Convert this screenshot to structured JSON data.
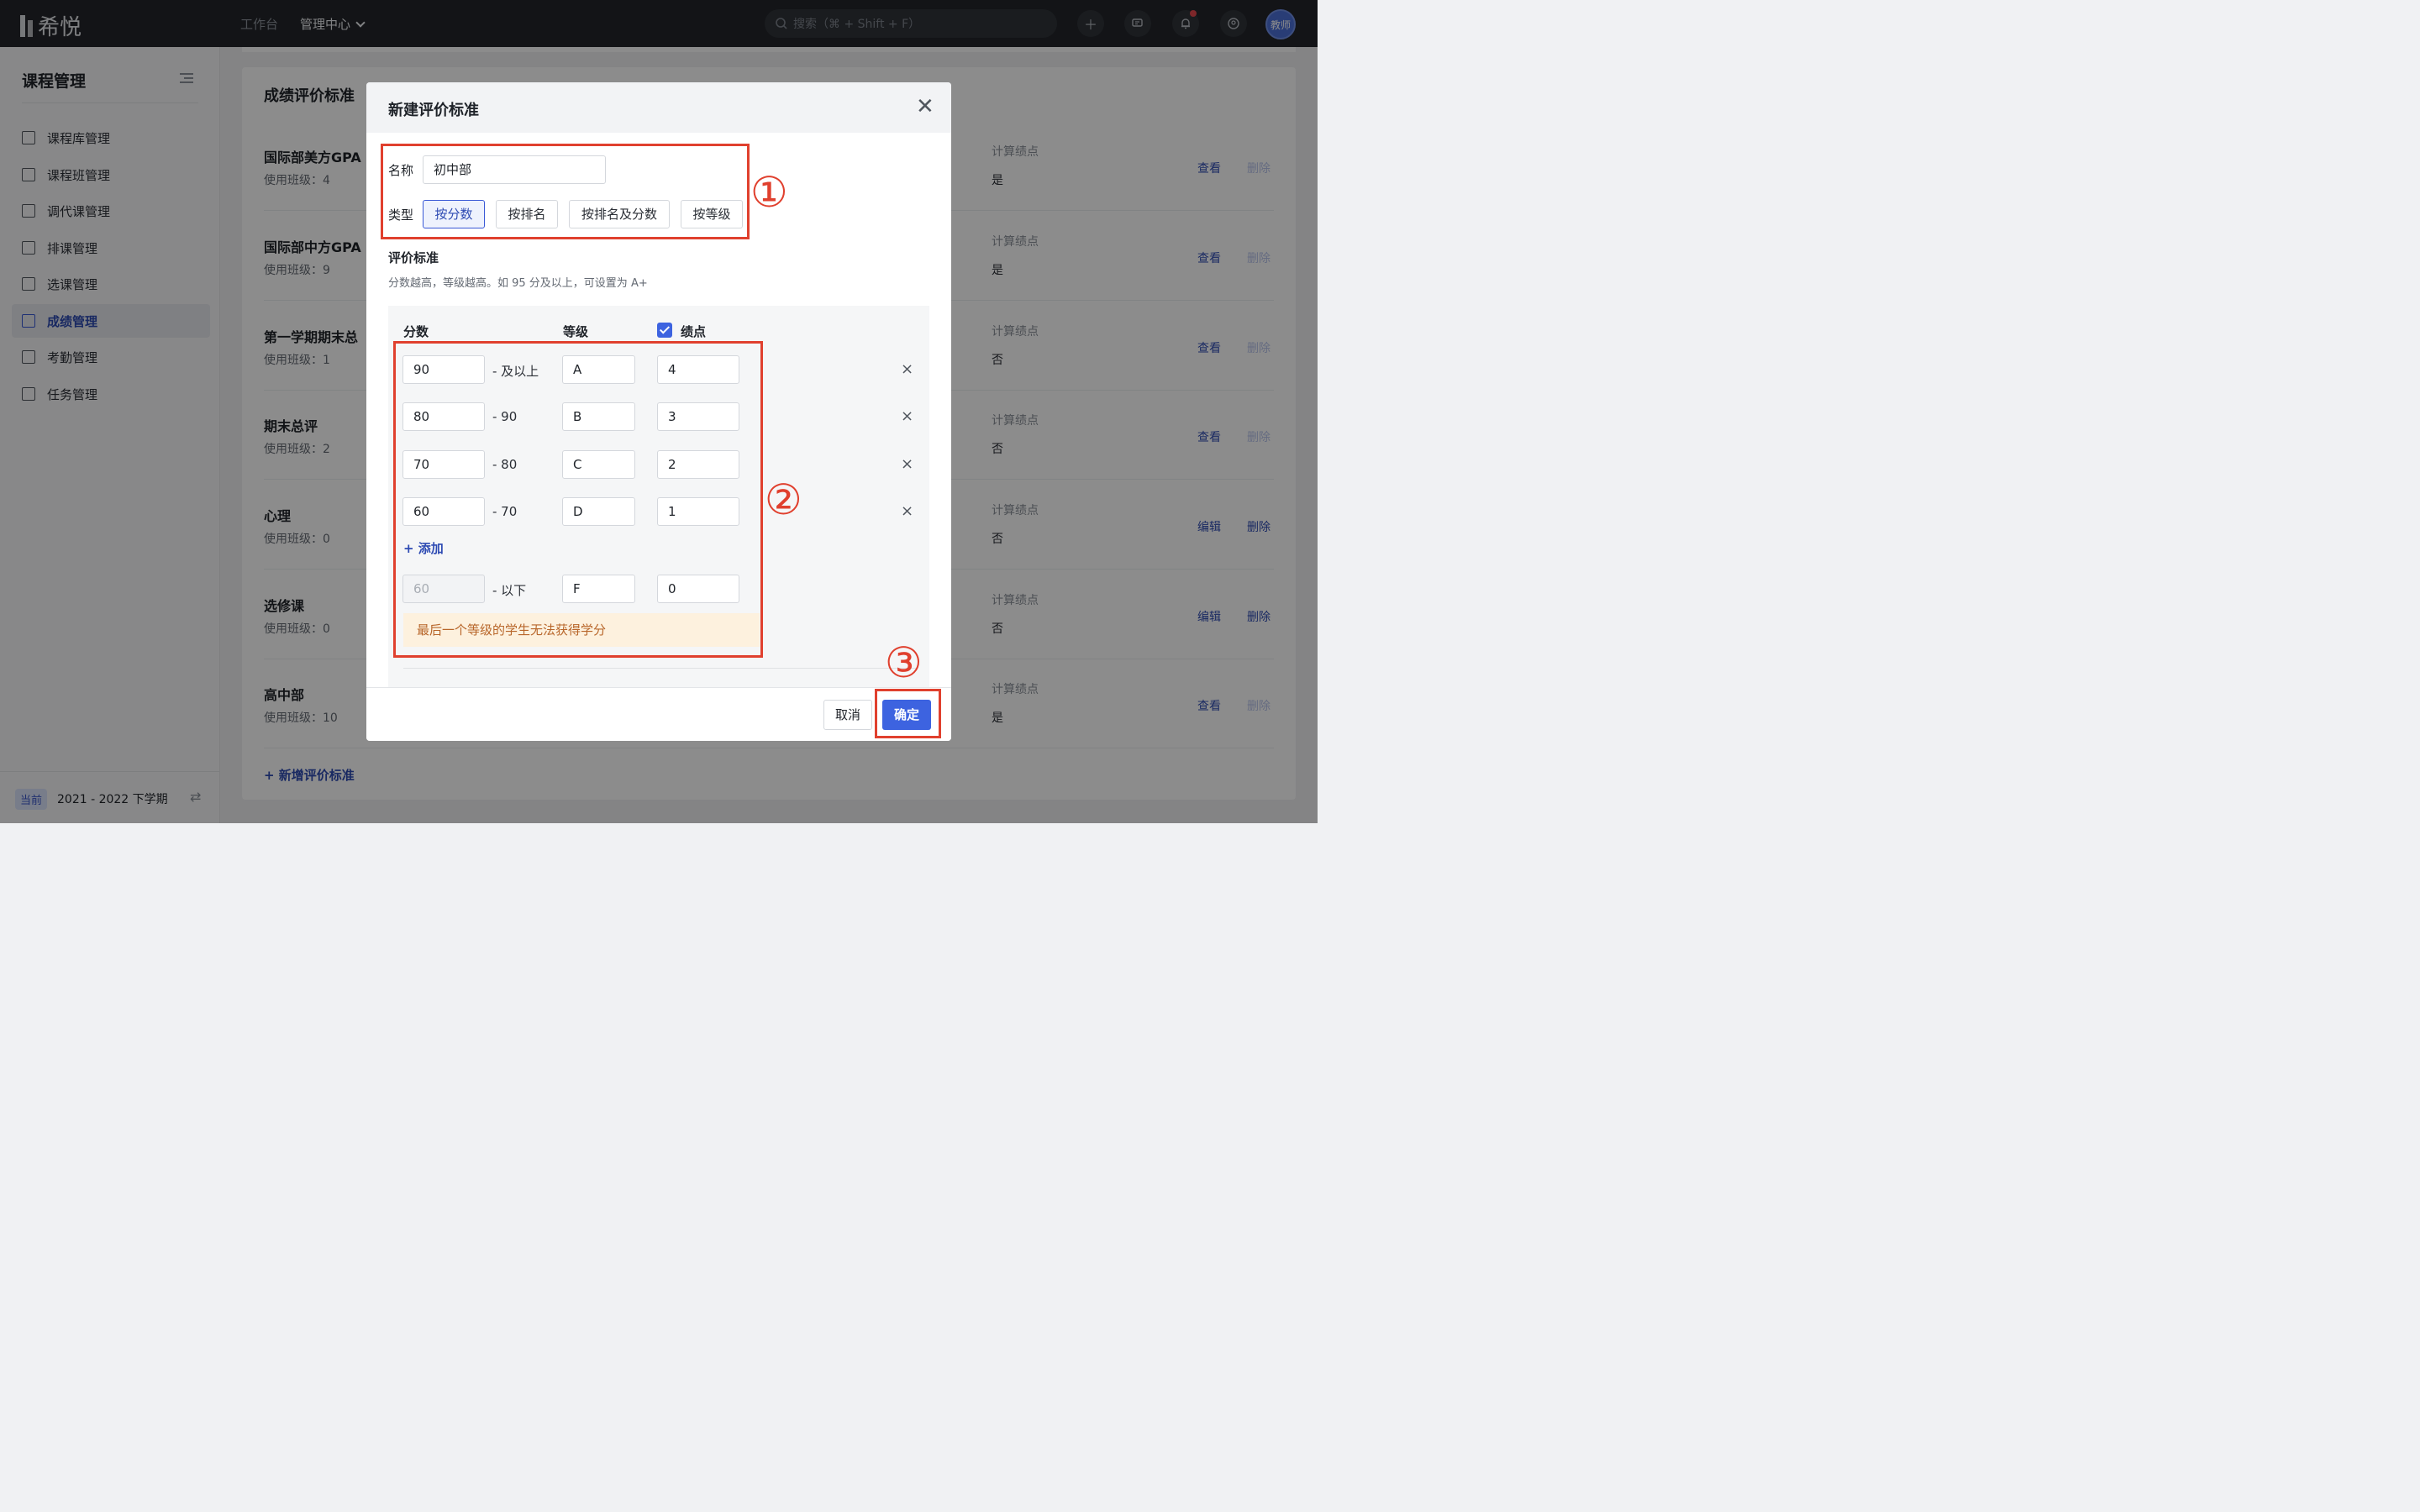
{
  "app": {
    "logo_text": "希悦"
  },
  "topnav": {
    "workbench": "工作台",
    "admin": "管理中心"
  },
  "search": {
    "placeholder": "搜索（⌘ + Shift + F）"
  },
  "avatar": {
    "label": "教师"
  },
  "sidebar": {
    "title": "课程管理",
    "items": [
      {
        "label": "课程库管理",
        "icon": "course-library-icon"
      },
      {
        "label": "课程班管理",
        "icon": "course-class-icon"
      },
      {
        "label": "调代课管理",
        "icon": "substitute-icon"
      },
      {
        "label": "排课管理",
        "icon": "schedule-icon"
      },
      {
        "label": "选课管理",
        "icon": "selection-icon"
      },
      {
        "label": "成绩管理",
        "icon": "grades-icon"
      },
      {
        "label": "考勤管理",
        "icon": "calendar-icon"
      },
      {
        "label": "任务管理",
        "icon": "tasks-icon"
      }
    ],
    "term_badge": "当前",
    "term": "2021 - 2022 下学期"
  },
  "card": {
    "title": "成绩评价标准",
    "add_label": "+ 新增评价标准",
    "gpa_label": "计算绩点",
    "rows": [
      {
        "name": "国际部美方GPA",
        "classes": "使用班级：4",
        "gpa": "是",
        "a1": "查看",
        "a2": "删除"
      },
      {
        "name": "国际部中方GPA",
        "classes": "使用班级：9",
        "gpa": "是",
        "a1": "查看",
        "a2": "删除"
      },
      {
        "name": "第一学期期末总",
        "classes": "使用班级：1",
        "gpa": "否",
        "a1": "查看",
        "a2": "删除"
      },
      {
        "name": "期末总评",
        "classes": "使用班级：2",
        "gpa": "否",
        "a1": "查看",
        "a2": "删除"
      },
      {
        "name": "心理",
        "classes": "使用班级：0",
        "gpa": "否",
        "a1": "编辑",
        "a2": "删除"
      },
      {
        "name": "选修课",
        "classes": "使用班级：0",
        "gpa": "否",
        "a1": "编辑",
        "a2": "删除"
      },
      {
        "name": "高中部",
        "classes": "使用班级：10",
        "gpa": "是",
        "a1": "查看",
        "a2": "删除"
      }
    ]
  },
  "modal": {
    "title": "新建评价标准",
    "name_label": "名称",
    "name_value": "初中部",
    "type_label": "类型",
    "types": [
      "按分数",
      "按排名",
      "按排名及分数",
      "按等级"
    ],
    "section_title": "评价标准",
    "section_desc": "分数越高，等级越高。如 95 分及以上，可设置为 A+",
    "col_score": "分数",
    "col_grade": "等级",
    "col_gpa": "绩点",
    "rows": [
      {
        "score": "90",
        "range": "- 及以上",
        "grade": "A",
        "gpa": "4"
      },
      {
        "score": "80",
        "range": "- 90",
        "grade": "B",
        "gpa": "3"
      },
      {
        "score": "70",
        "range": "- 80",
        "grade": "C",
        "gpa": "2"
      },
      {
        "score": "60",
        "range": "- 70",
        "grade": "D",
        "gpa": "1"
      }
    ],
    "add_label": "+ 添加",
    "last_row": {
      "score": "60",
      "range": "- 以下",
      "grade": "F",
      "gpa": "0"
    },
    "warning": "最后一个等级的学生无法获得学分",
    "cancel": "取消",
    "confirm": "确定"
  },
  "annotations": [
    "①",
    "②",
    "③"
  ],
  "colors": {
    "accent": "#3d63e0",
    "annotation": "#e0402e",
    "topbar": "#23262b"
  }
}
